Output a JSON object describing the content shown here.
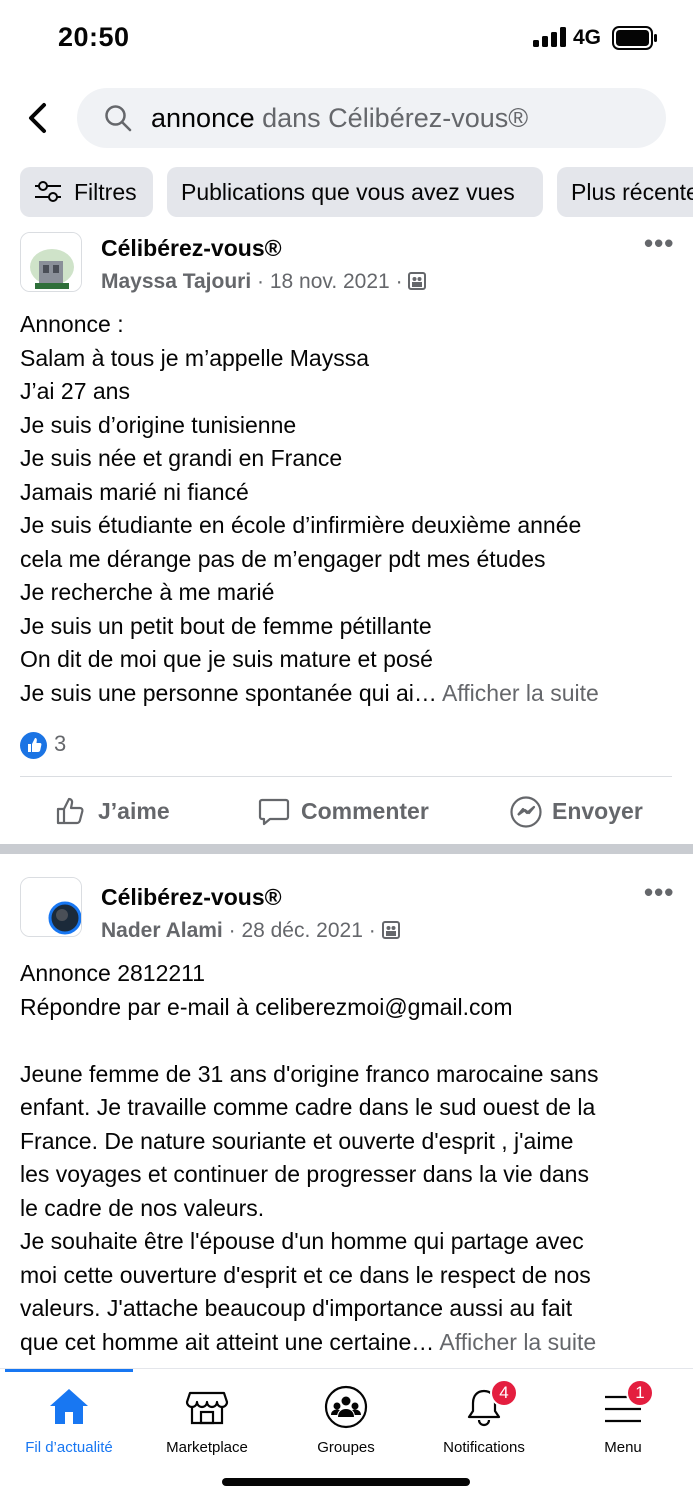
{
  "status_bar": {
    "time": "20:50",
    "network": "4G"
  },
  "search": {
    "term": "annonce",
    "scope": "dans Célibérez-vous®"
  },
  "filters": [
    "Filtres",
    "Publications que vous avez vues",
    "Plus récentes"
  ],
  "posts": [
    {
      "group": "Célibérez-vous®",
      "author": "Mayssa Tajouri",
      "date": "18 nov. 2021",
      "lines": [
        "Annonce :",
        "Salam à tous je m’appelle Mayssa",
        "J’ai 27 ans",
        "Je suis d’origine tunisienne",
        "Je suis née et grandi en France",
        "Jamais marié ni fiancé",
        "Je suis étudiante en école d’infirmière deuxième année",
        "cela me dérange pas de m’engager pdt mes études",
        "Je recherche à me marié",
        "Je suis un petit bout de femme pétillante",
        "On dit de moi que je suis mature et posé",
        "Je suis une personne spontanée qui ai…"
      ],
      "see_more": "Afficher la suite",
      "reaction_count": "3"
    },
    {
      "group": "Célibérez-vous®",
      "author": "Nader Alami",
      "date": "28 déc. 2021",
      "lines": [
        "Annonce 2812211",
        "Répondre par e-mail à celiberezmoi@gmail.com",
        "",
        "Jeune femme de 31 ans d'origine franco marocaine sans",
        "enfant. Je travaille comme cadre dans le sud ouest de la",
        "France. De nature souriante et ouverte d'esprit , j'aime",
        "les voyages et continuer de progresser dans la vie dans",
        "le cadre de nos valeurs.",
        "Je souhaite être l'épouse d'un homme qui partage avec",
        "moi cette ouverture d'esprit et ce dans le respect de nos",
        "valeurs. J'attache beaucoup d'importance aussi au fait",
        "que cet homme ait atteint une certaine…"
      ],
      "see_more": "Afficher la suite"
    }
  ],
  "actions": {
    "like": "J’aime",
    "comment": "Commenter",
    "send": "Envoyer"
  },
  "nav": {
    "items": [
      "Fil d’actualité",
      "Marketplace",
      "Groupes",
      "Notifications",
      "Menu"
    ],
    "notifications_badge": "4",
    "menu_badge": "1"
  },
  "colors": {
    "accent": "#1877f2",
    "badge": "#e41e3f",
    "muted": "#65676b"
  }
}
